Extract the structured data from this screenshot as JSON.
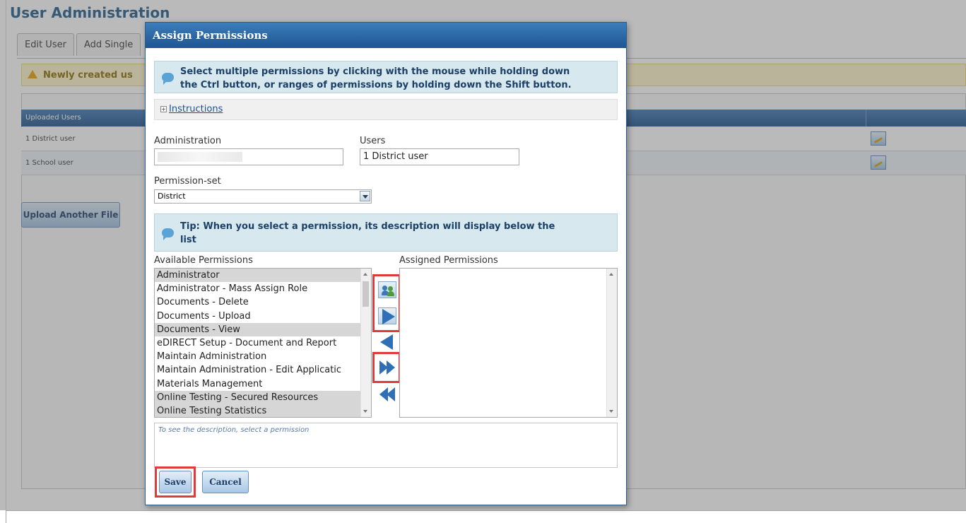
{
  "page": {
    "title": "User Administration",
    "tabs": [
      "Edit User",
      "Add Single"
    ],
    "warning_text": "Newly created us",
    "table_header": "Uploaded Users",
    "rows": [
      {
        "label": "1 District user"
      },
      {
        "label": "1 School user"
      }
    ],
    "upload_button_label": "Upload Another File"
  },
  "dialog": {
    "title": "Assign Permissions",
    "info_line1": "Select multiple permissions by clicking with the mouse while holding down",
    "info_line2": "the Ctrl button, or ranges of permissions by holding down the Shift button.",
    "instructions_label": "Instructions",
    "instructions_toggle": "+",
    "administration_label": "Administration",
    "administration_value": "",
    "users_label": "Users",
    "users_value": "1 District user",
    "permission_set_label": "Permission-set",
    "permission_set_value": "District",
    "tip_line1": "Tip: When you select a permission, its description will display below the",
    "tip_line2": "list",
    "available_label": "Available Permissions",
    "assigned_label": "Assigned Permissions",
    "available_permissions": [
      {
        "label": "Administrator",
        "selected": true
      },
      {
        "label": "Administrator - Mass Assign Role",
        "selected": false
      },
      {
        "label": "Documents - Delete",
        "selected": false
      },
      {
        "label": "Documents - Upload",
        "selected": false
      },
      {
        "label": "Documents - View",
        "selected": true
      },
      {
        "label": "eDIRECT Setup - Document and Report",
        "selected": false
      },
      {
        "label": "Maintain Administration",
        "selected": false
      },
      {
        "label": "Maintain Administration - Edit Applicatic",
        "selected": false
      },
      {
        "label": "Materials Management",
        "selected": false
      },
      {
        "label": "Online Testing - Secured Resources",
        "selected": true
      },
      {
        "label": "Online Testing Statistics",
        "selected": true
      }
    ],
    "assigned_permissions": [],
    "description_placeholder": "To see the description, select a permission",
    "save_label": "Save",
    "cancel_label": "Cancel"
  },
  "colors": {
    "title_bar": "#1e5592",
    "info_bg": "#d7e9ef",
    "highlight": "#e03a3a",
    "arrow": "#2e6fb6"
  },
  "icons": [
    "warning-icon",
    "edit-icon",
    "info-bubble-icon",
    "expand-icon",
    "dropdown-arrow-icon",
    "assign-users-icon",
    "move-right-icon",
    "move-left-icon",
    "move-all-right-icon",
    "move-all-left-icon"
  ]
}
